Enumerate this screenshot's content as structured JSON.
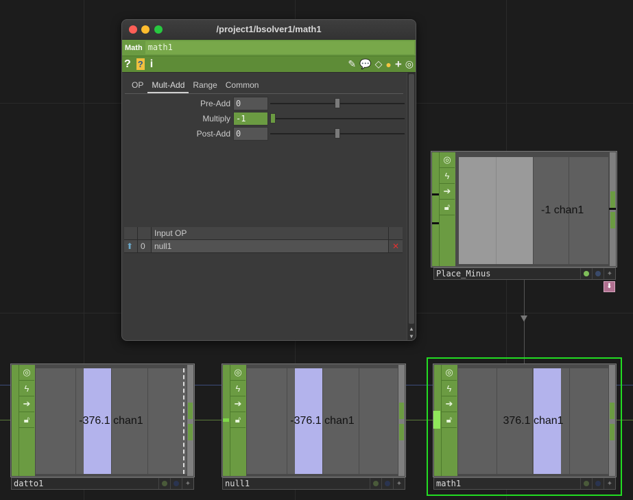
{
  "window": {
    "title": "/project1/bsolver1/math1",
    "op_type": "Math",
    "op_name": "math1",
    "tabs": [
      "OP",
      "Mult-Add",
      "Range",
      "Common"
    ],
    "active_tab": "Mult-Add",
    "params": {
      "preadd": {
        "label": "Pre-Add",
        "value": "0",
        "slider": 0.5
      },
      "multiply": {
        "label": "Multiply",
        "value": "-1",
        "slider": 0.0
      },
      "postadd": {
        "label": "Post-Add",
        "value": "0",
        "slider": 0.5
      }
    },
    "input_table": {
      "header": "Input OP",
      "row_index": "0",
      "row_value": "null1"
    }
  },
  "nodes": {
    "place_minus": {
      "name": "Place_Minus",
      "value": "-1",
      "chan": "chan1"
    },
    "datto1": {
      "name": "datto1",
      "value": "-376.1",
      "chan": "chan1"
    },
    "null1": {
      "name": "null1",
      "value": "-376.1",
      "chan": "chan1"
    },
    "math1": {
      "name": "math1",
      "value": "376.1",
      "chan": "chan1"
    }
  },
  "colors": {
    "op_green": "#6b9b42",
    "selected_outline": "#22dd22",
    "bar_lavender": "#b3b3ec",
    "background": "#1c1c1c"
  }
}
